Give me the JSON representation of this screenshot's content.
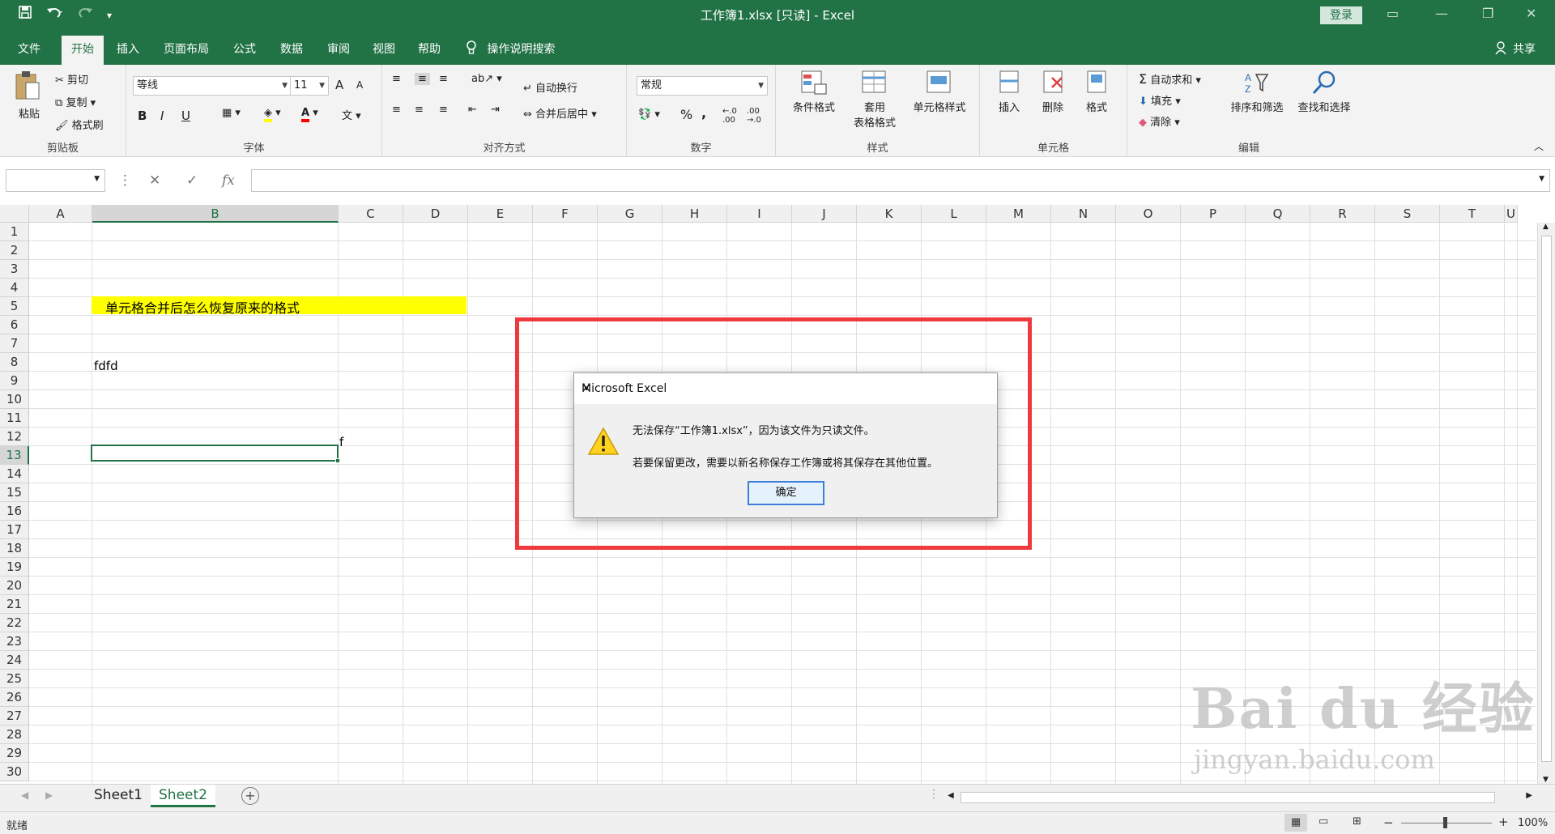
{
  "window": {
    "title": "工作簿1.xlsx  [只读]  -  Excel",
    "login_label": "登录",
    "qat_save_icon": "save-icon",
    "qat_undo_icon": "undo-icon",
    "qat_redo_icon": "redo-icon"
  },
  "ribbon_tabs": [
    "文件",
    "开始",
    "插入",
    "页面布局",
    "公式",
    "数据",
    "审阅",
    "视图",
    "帮助"
  ],
  "tell_me": "操作说明搜索",
  "share": "共享",
  "ribbon": {
    "clipboard": {
      "paste": "粘贴",
      "cut": "剪切",
      "copy": "复制",
      "format_painter": "格式刷",
      "label": "剪贴板"
    },
    "font": {
      "name": "等线",
      "size": "11",
      "label": "字体",
      "bold": "B",
      "italic": "I",
      "underline": "U",
      "grow": "A",
      "shrink": "A"
    },
    "alignment": {
      "wrap": "自动换行",
      "merge": "合并后居中",
      "label": "对齐方式"
    },
    "number": {
      "format": "常规",
      "percent": "%",
      "comma": ",",
      "label": "数字"
    },
    "styles": {
      "conditional": "条件格式",
      "table1": "套用",
      "table2": "表格格式",
      "cell_styles": "单元格样式",
      "label": "样式"
    },
    "cells": {
      "insert": "插入",
      "delete": "删除",
      "format": "格式",
      "label": "单元格"
    },
    "editing": {
      "autosum": "自动求和",
      "fill": "填充",
      "clear": "清除",
      "sort": "排序和筛选",
      "find": "查找和选择",
      "label": "编辑"
    }
  },
  "formula_bar": {
    "name_box": "",
    "fx": "fx",
    "content": ""
  },
  "columns": [
    "A",
    "B",
    "C",
    "D",
    "E",
    "F",
    "G",
    "H",
    "I",
    "J",
    "K",
    "L",
    "M",
    "N",
    "O",
    "P",
    "Q",
    "R",
    "S",
    "T",
    "U"
  ],
  "rows": [
    "1",
    "2",
    "3",
    "4",
    "5",
    "6",
    "7",
    "8",
    "9",
    "10",
    "11",
    "12",
    "13",
    "14",
    "15",
    "16",
    "17",
    "18",
    "19",
    "20",
    "21",
    "22",
    "23",
    "24",
    "25",
    "26",
    "27",
    "28",
    "29",
    "30"
  ],
  "cells": {
    "B5": "单元格合并后怎么恢复原来的格式",
    "B9": "fdfd",
    "C14": "f",
    "highlight_color": "#ffff00"
  },
  "sheets": [
    "Sheet1",
    "Sheet2"
  ],
  "active_sheet": "Sheet2",
  "status": {
    "ready": "就绪",
    "zoom": "100%",
    "minus": "−",
    "plus": "+"
  },
  "dialog": {
    "title": "Microsoft Excel",
    "line1": "无法保存“工作簿1.xlsx”，因为该文件为只读文件。",
    "line2": "若要保留更改，需要以新名称保存工作簿或将其保存在其他位置。",
    "ok": "确定",
    "icon": "warning-icon"
  },
  "watermark": {
    "line1": "Bai du 经验",
    "line2": "jingyan.baidu.com"
  },
  "colors": {
    "excel_green": "#217346",
    "annotation_red": "#ee3a3f",
    "cell_highlight": "#ffff00"
  }
}
